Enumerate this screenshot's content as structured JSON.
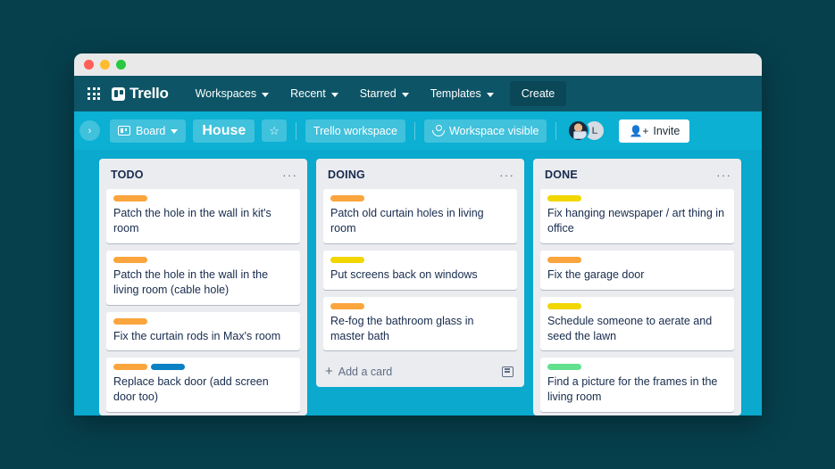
{
  "window": {
    "traffic_lights": [
      "close",
      "minimize",
      "maximize"
    ]
  },
  "topnav": {
    "apps_icon": "grid-apps-icon",
    "brand": "Trello",
    "items": [
      {
        "label": "Workspaces",
        "has_chevron": true
      },
      {
        "label": "Recent",
        "has_chevron": true
      },
      {
        "label": "Starred",
        "has_chevron": true
      },
      {
        "label": "Templates",
        "has_chevron": true
      }
    ],
    "create_label": "Create"
  },
  "boardbar": {
    "sidebar_toggle": "›",
    "view_label": "Board",
    "board_title": "House",
    "star_glyph": "☆",
    "workspace_label": "Trello workspace",
    "visibility_label": "Workspace visible",
    "members": [
      {
        "type": "photo",
        "initial": ""
      },
      {
        "type": "initial",
        "initial": "L"
      }
    ],
    "invite_label": "Invite"
  },
  "lists": [
    {
      "title": "TODO",
      "menu": "···",
      "scrollable": true,
      "show_add_card": false,
      "cards": [
        {
          "labels": [
            "#faa53d"
          ],
          "title": "Patch the hole in the wall in kit's room"
        },
        {
          "labels": [
            "#faa53d"
          ],
          "title": "Patch the hole in the wall in the living room (cable hole)"
        },
        {
          "labels": [
            "#faa53d"
          ],
          "title": "Fix the curtain rods in Max's room"
        },
        {
          "labels": [
            "#faa53d",
            "#0c80c4"
          ],
          "title": "Replace back door (add screen door too)"
        },
        {
          "labels": [
            "#faa53d"
          ],
          "title": ""
        }
      ]
    },
    {
      "title": "DOING",
      "menu": "···",
      "scrollable": false,
      "show_add_card": true,
      "add_card_label": "Add a card",
      "add_card_plus": "+",
      "template_icon": "card-template-icon",
      "cards": [
        {
          "labels": [
            "#faa53d"
          ],
          "title": "Patch old curtain holes in living room"
        },
        {
          "labels": [
            "#f2d600"
          ],
          "title": "Put screens back on windows"
        },
        {
          "labels": [
            "#faa53d"
          ],
          "title": "Re-fog the bathroom glass in master bath"
        }
      ]
    },
    {
      "title": "DONE",
      "menu": "···",
      "scrollable": true,
      "show_add_card": false,
      "cards": [
        {
          "labels": [
            "#f2d600"
          ],
          "title": "Fix hanging newspaper / art thing in office"
        },
        {
          "labels": [
            "#faa53d"
          ],
          "title": "Fix the garage door"
        },
        {
          "labels": [
            "#f2d600"
          ],
          "title": "Schedule someone to aerate and seed the lawn"
        },
        {
          "labels": [
            "#61e08e"
          ],
          "title": "Find a picture for the frames in the living room"
        },
        {
          "labels": [
            "#f2d600"
          ],
          "title": ""
        }
      ]
    }
  ],
  "colors": {
    "page_background": "#06404d",
    "top_nav": "#0d5566",
    "board_bar": "#0bb0d3",
    "board_canvas": "#0aa9cd",
    "list_background": "#ebecf0",
    "card_background": "#ffffff",
    "text_primary": "#172b4d",
    "text_muted": "#5e6c84"
  }
}
